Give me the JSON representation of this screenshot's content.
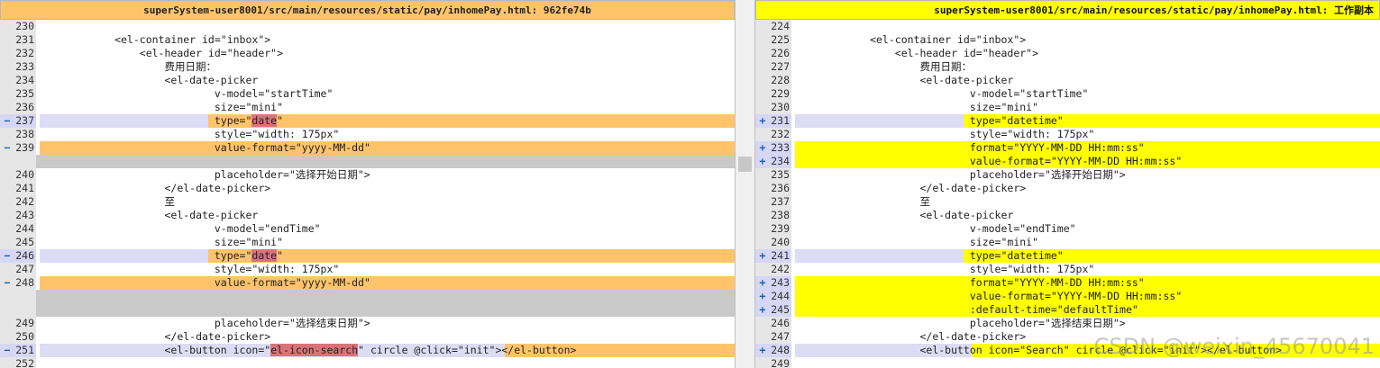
{
  "left": {
    "title": "superSystem-user8001/src/main/resources/static/pay/inhomePay.html: 962fe74b",
    "lines": [
      {
        "n": "230",
        "t": "",
        "k": "normal"
      },
      {
        "n": "231",
        "t": "            <el-container id=\"inbox\">",
        "k": "normal"
      },
      {
        "n": "232",
        "t": "                <el-header id=\"header\">",
        "k": "normal"
      },
      {
        "n": "233",
        "t": "                    费用日期：",
        "k": "normal"
      },
      {
        "n": "234",
        "t": "                    <el-date-picker",
        "k": "normal"
      },
      {
        "n": "235",
        "t": "                            v-model=\"startTime\"",
        "k": "normal"
      },
      {
        "n": "236",
        "t": "                            size=\"mini\"",
        "k": "normal"
      },
      {
        "n": "237",
        "t": "                            type=\"",
        "h": "date",
        "a": "\"",
        "k": "changed",
        "m": "-",
        "split": 231
      },
      {
        "n": "238",
        "t": "                            style=\"width: 175px\"",
        "k": "normal"
      },
      {
        "n": "239",
        "t": "                            value-format=\"yyyy-MM-dd\"",
        "k": "full",
        "m": "-"
      },
      {
        "n": "",
        "t": "",
        "k": "blank"
      },
      {
        "n": "240",
        "t": "                            placeholder=\"选择开始日期\">",
        "k": "normal"
      },
      {
        "n": "241",
        "t": "                    </el-date-picker>",
        "k": "normal"
      },
      {
        "n": "242",
        "t": "                    至",
        "k": "normal"
      },
      {
        "n": "243",
        "t": "                    <el-date-picker",
        "k": "normal"
      },
      {
        "n": "244",
        "t": "                            v-model=\"endTime\"",
        "k": "normal"
      },
      {
        "n": "245",
        "t": "                            size=\"mini\"",
        "k": "normal"
      },
      {
        "n": "246",
        "t": "                            type=\"",
        "h": "date",
        "a": "\"",
        "k": "changed",
        "m": "-",
        "split": 231
      },
      {
        "n": "247",
        "t": "                            style=\"width: 175px\"",
        "k": "normal"
      },
      {
        "n": "248",
        "t": "                            value-format=\"yyyy-MM-dd\"",
        "k": "full",
        "m": "-"
      },
      {
        "n": "",
        "t": "",
        "k": "blank"
      },
      {
        "n": "",
        "t": "",
        "k": "blank"
      },
      {
        "n": "249",
        "t": "                            placeholder=\"选择结束日期\">",
        "k": "normal"
      },
      {
        "n": "250",
        "t": "                    </el-date-picker>",
        "k": "normal"
      },
      {
        "n": "251",
        "t": "                    <el-button icon=\"",
        "h": "el-icon-search",
        "a": "\" circle @click=\"init\"></el-button>",
        "k": "changed",
        "m": "-",
        "split": 560
      },
      {
        "n": "252",
        "t": "",
        "k": "normal"
      }
    ]
  },
  "right": {
    "title": "superSystem-user8001/src/main/resources/static/pay/inhomePay.html: 工作副本",
    "lines": [
      {
        "n": "224",
        "t": "",
        "k": "normal"
      },
      {
        "n": "225",
        "t": "            <el-container id=\"inbox\">",
        "k": "normal"
      },
      {
        "n": "226",
        "t": "                <el-header id=\"header\">",
        "k": "normal"
      },
      {
        "n": "227",
        "t": "                    费用日期：",
        "k": "normal"
      },
      {
        "n": "228",
        "t": "                    <el-date-picker",
        "k": "normal"
      },
      {
        "n": "229",
        "t": "                            v-model=\"startTime\"",
        "k": "normal"
      },
      {
        "n": "230",
        "t": "                            size=\"mini\"",
        "k": "normal"
      },
      {
        "n": "231",
        "t": "                            type=\"",
        "h": "datetime",
        "a": "\"",
        "k": "changed",
        "m": "+",
        "split": 231
      },
      {
        "n": "232",
        "t": "                            style=\"width: 175px\"",
        "k": "normal"
      },
      {
        "n": "233",
        "t": "                            format=\"YYYY-MM-DD HH:mm:ss\"",
        "k": "full",
        "m": "+"
      },
      {
        "n": "234",
        "t": "                            value-format=\"YYYY-MM-DD HH:mm:ss\"",
        "k": "full",
        "m": "+"
      },
      {
        "n": "235",
        "t": "                            placeholder=\"选择开始日期\">",
        "k": "normal"
      },
      {
        "n": "236",
        "t": "                    </el-date-picker>",
        "k": "normal"
      },
      {
        "n": "237",
        "t": "                    至",
        "k": "normal"
      },
      {
        "n": "238",
        "t": "                    <el-date-picker",
        "k": "normal"
      },
      {
        "n": "239",
        "t": "                            v-model=\"endTime\"",
        "k": "normal"
      },
      {
        "n": "240",
        "t": "                            size=\"mini\"",
        "k": "normal"
      },
      {
        "n": "241",
        "t": "                            type=\"",
        "h": "datetime",
        "a": "\"",
        "k": "changed",
        "m": "+",
        "split": 231
      },
      {
        "n": "242",
        "t": "                            style=\"width: 175px\"",
        "k": "normal"
      },
      {
        "n": "243",
        "t": "                            format=\"YYYY-MM-DD HH:mm:ss\"",
        "k": "full",
        "m": "+"
      },
      {
        "n": "244",
        "t": "                            value-format=\"YYYY-MM-DD HH:mm:ss\"",
        "k": "full",
        "m": "+"
      },
      {
        "n": "245",
        "t": "                            :default-time=\"defaultTime\"",
        "k": "full",
        "m": "+"
      },
      {
        "n": "246",
        "t": "                            placeholder=\"选择结束日期\">",
        "k": "normal"
      },
      {
        "n": "247",
        "t": "                    </el-date-picker>",
        "k": "normal"
      },
      {
        "n": "248",
        "t": "                    <el-button icon=\"",
        "h": "Search",
        "a": "\" circle @click=\"init\"></el-button>",
        "k": "changed",
        "m": "+",
        "split": 240
      },
      {
        "n": "249",
        "t": "",
        "k": "normal"
      }
    ]
  },
  "watermark": "CSDN @weixin_45670041",
  "colors": {
    "left_header": "#ffc46a",
    "right_header": "#ffff00",
    "left_change": "#ffc46a",
    "right_change": "#ffff00",
    "word_removed": "#d9737a",
    "unchanged_gap": "#c9c9c9"
  }
}
